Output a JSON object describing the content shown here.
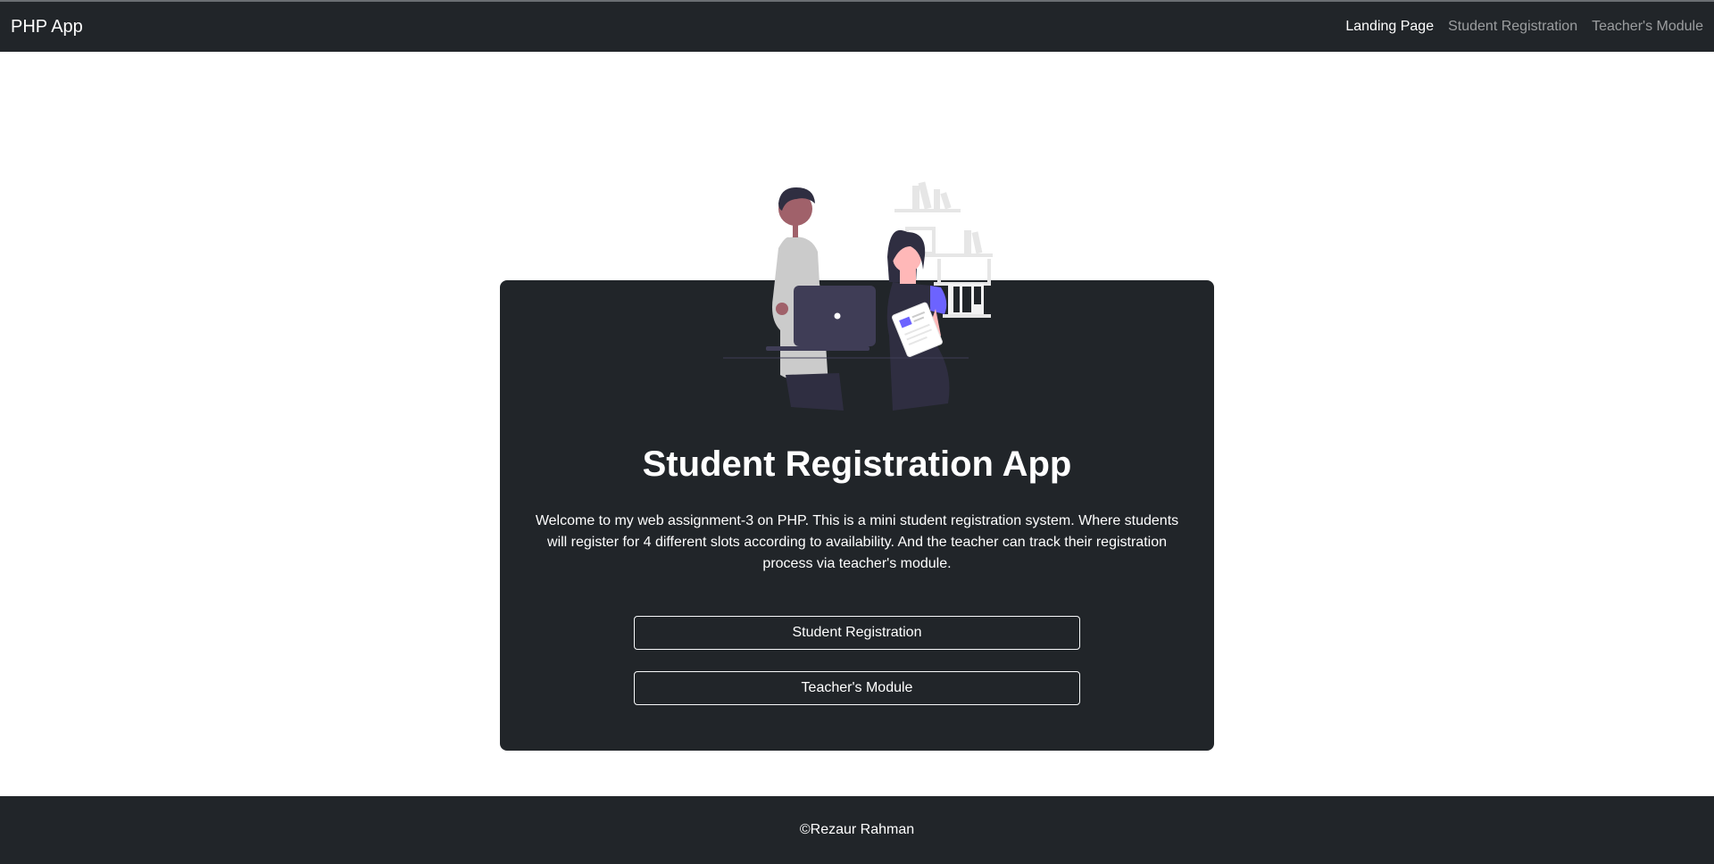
{
  "navbar": {
    "brand": "PHP App",
    "links": [
      {
        "label": "Landing Page",
        "active": true
      },
      {
        "label": "Student Registration",
        "active": false
      },
      {
        "label": "Teacher's Module",
        "active": false
      }
    ]
  },
  "hero": {
    "illustration": "people-with-laptop-illustration",
    "title": "Student Registration App",
    "description": "Welcome to my web assignment-3 on PHP. This is a mini student registration system. Where students will register for 4 different slots according to availability. And the teacher can track their registration process via teacher's module.",
    "buttons": {
      "student_registration": "Student Registration",
      "teachers_module": "Teacher's Module"
    }
  },
  "footer": {
    "text": "©Rezaur Rahman"
  },
  "colors": {
    "dark": "#212529",
    "accent": "#6c63ff",
    "skin_dark": "#a0616a",
    "skin_light": "#ffb8b8",
    "muted_gray": "#cbcbcb"
  }
}
